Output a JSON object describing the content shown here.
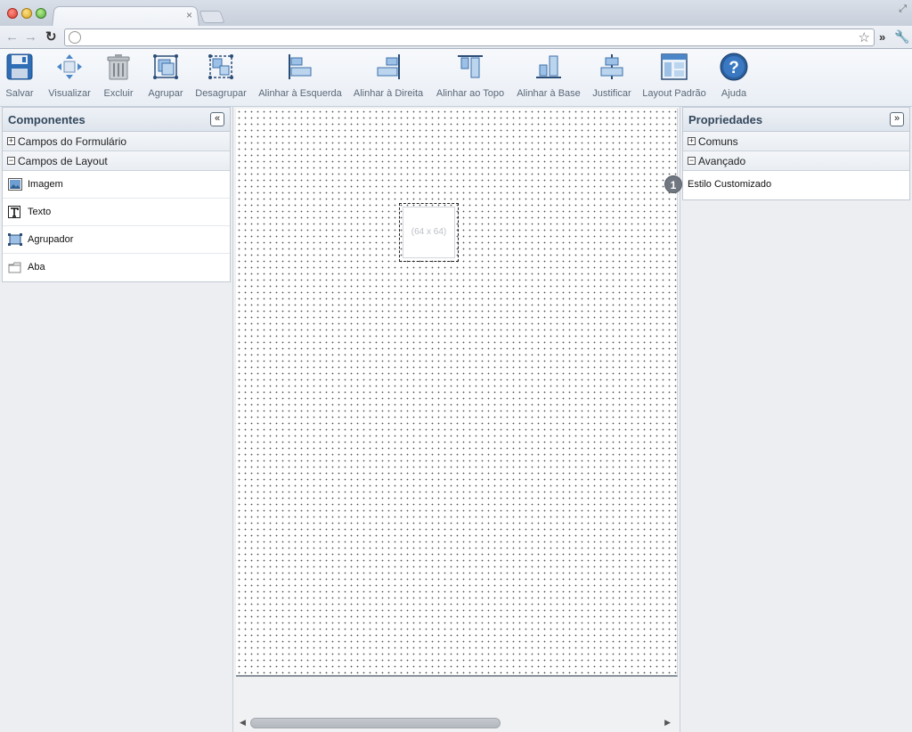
{
  "browser": {
    "tab_close": "×",
    "icons": [
      "back-icon",
      "forward-icon",
      "reload-icon",
      "globe-icon",
      "star-icon",
      "more-icon",
      "wrench-icon"
    ]
  },
  "toolbar": {
    "buttons": [
      {
        "label": "Salvar",
        "icon": "save-icon"
      },
      {
        "label": "Visualizar",
        "icon": "preview-icon"
      },
      {
        "label": "Excluir",
        "icon": "trash-icon"
      },
      {
        "label": "Agrupar",
        "icon": "group-icon"
      },
      {
        "label": "Desagrupar",
        "icon": "ungroup-icon"
      },
      {
        "label": "Alinhar à Esquerda",
        "icon": "align-left-icon"
      },
      {
        "label": "Alinhar à Direita",
        "icon": "align-right-icon"
      },
      {
        "label": "Alinhar ao Topo",
        "icon": "align-top-icon"
      },
      {
        "label": "Alinhar à Base",
        "icon": "align-bottom-icon"
      },
      {
        "label": "Justificar",
        "icon": "justify-icon"
      },
      {
        "label": "Layout Padrão",
        "icon": "default-layout-icon"
      },
      {
        "label": "Ajuda",
        "icon": "help-icon"
      }
    ]
  },
  "left_panel": {
    "title": "Componentes",
    "collapse_symbol": "«",
    "sections": [
      {
        "toggle": "+",
        "label": "Campos do Formulário"
      },
      {
        "toggle": "−",
        "label": "Campos de Layout"
      }
    ],
    "items": [
      {
        "label": "Imagem",
        "icon": "image-icon"
      },
      {
        "label": "Texto",
        "icon": "text-icon"
      },
      {
        "label": "Agrupador",
        "icon": "group-container-icon"
      },
      {
        "label": "Aba",
        "icon": "tab-icon"
      }
    ]
  },
  "right_panel": {
    "title": "Propriedades",
    "collapse_symbol": "»",
    "sections": [
      {
        "toggle": "+",
        "label": "Comuns"
      },
      {
        "toggle": "−",
        "label": "Avançado"
      }
    ],
    "items": [
      {
        "label": "Estilo Customizado",
        "badge": "1"
      }
    ]
  },
  "canvas": {
    "image_placeholder": "(64 x 64)",
    "scroll_left": "◀",
    "scroll_right": "▶"
  }
}
